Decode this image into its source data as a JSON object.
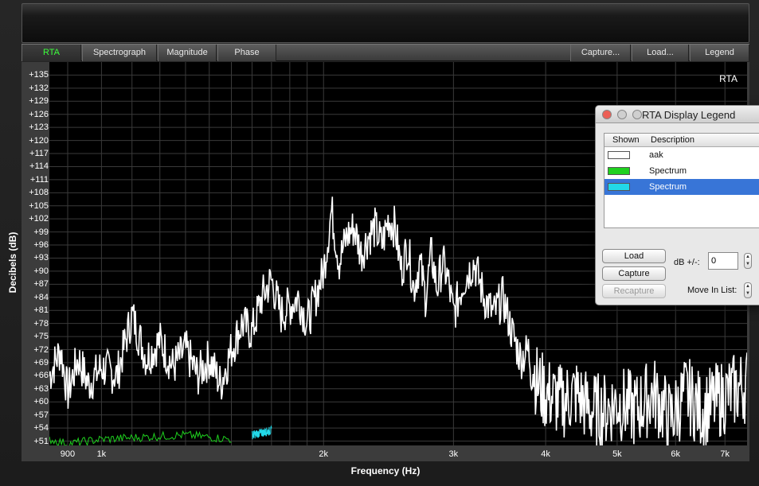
{
  "tabs": [
    {
      "label": "RTA",
      "active": true
    },
    {
      "label": "Spectrograph",
      "active": false
    },
    {
      "label": "Magnitude",
      "active": false
    },
    {
      "label": "Phase",
      "active": false
    }
  ],
  "right_tabs": [
    {
      "label": "Capture..."
    },
    {
      "label": "Load..."
    },
    {
      "label": "Legend"
    }
  ],
  "plot": {
    "mode_label": "RTA",
    "xlabel": "Frequency (Hz)",
    "ylabel": "Decibels (dB)"
  },
  "chart_data": {
    "type": "line",
    "title": "",
    "xlabel": "Frequency (Hz)",
    "ylabel": "Decibels (dB)",
    "x_scale": "log",
    "xlim": [
      850,
      7500
    ],
    "ylim": [
      50,
      138
    ],
    "grid": true,
    "y_ticks": [
      "+135",
      "+132",
      "+129",
      "+126",
      "+123",
      "+120",
      "+117",
      "+114",
      "+111",
      "+108",
      "+105",
      "+102",
      "+99",
      "+96",
      "+93",
      "+90",
      "+87",
      "+84",
      "+81",
      "+78",
      "+75",
      "+72",
      "+69",
      "+66",
      "+63",
      "+60",
      "+57",
      "+54",
      "+51"
    ],
    "x_ticks": [
      "900",
      "1k",
      "2k",
      "3k",
      "4k",
      "5k",
      "6k",
      "7k"
    ],
    "series": [
      {
        "name": "aak",
        "color": "#ffffff",
        "x": [
          850,
          880,
          900,
          930,
          960,
          1000,
          1050,
          1100,
          1150,
          1200,
          1250,
          1300,
          1350,
          1400,
          1450,
          1500,
          1550,
          1600,
          1650,
          1700,
          1750,
          1800,
          1850,
          1900,
          1950,
          2000,
          2050,
          2100,
          2150,
          2200,
          2250,
          2300,
          2350,
          2400,
          2450,
          2500,
          2550,
          2600,
          2650,
          2700,
          2750,
          2800,
          2850,
          2900,
          2950,
          3000,
          3100,
          3200,
          3300,
          3400,
          3500,
          3600,
          3700,
          3800,
          3900,
          4000,
          4200,
          4400,
          4600,
          4800,
          5000,
          5300,
          5600,
          5900,
          6200,
          6500,
          6800,
          7100,
          7500
        ],
        "y": [
          66,
          72,
          62,
          70,
          64,
          68,
          66,
          80,
          70,
          74,
          68,
          72,
          66,
          70,
          64,
          72,
          78,
          76,
          84,
          88,
          80,
          82,
          84,
          78,
          84,
          90,
          104,
          92,
          98,
          100,
          94,
          98,
          100,
          96,
          102,
          100,
          90,
          96,
          86,
          92,
          84,
          94,
          86,
          92,
          88,
          80,
          88,
          92,
          84,
          80,
          84,
          76,
          70,
          72,
          64,
          62,
          60,
          62,
          58,
          58,
          60,
          58,
          62,
          56,
          62,
          58,
          60,
          62,
          64
        ]
      },
      {
        "name": "Spectrum",
        "color": "#1fd11f",
        "x": [
          850,
          900,
          1000,
          1300,
          1500
        ],
        "y": [
          51,
          50,
          51,
          52,
          51
        ]
      },
      {
        "name": "Spectrum",
        "color": "#22d8e8",
        "x": [
          1600,
          1700
        ],
        "y": [
          52,
          53
        ]
      }
    ]
  },
  "legend": {
    "title": "RTA Display Legend",
    "columns": [
      "Shown",
      "Description"
    ],
    "rows": [
      {
        "description": "aak",
        "color": "#ffffff",
        "selected": false
      },
      {
        "description": "Spectrum",
        "color": "#1fd11f",
        "selected": false
      },
      {
        "description": "Spectrum",
        "color": "#22d8e8",
        "selected": true
      }
    ],
    "load_label": "Load",
    "capture_label": "Capture",
    "recapture_label": "Recapture",
    "db_label": "dB +/-:",
    "db_value": "0",
    "move_label": "Move In List:"
  }
}
